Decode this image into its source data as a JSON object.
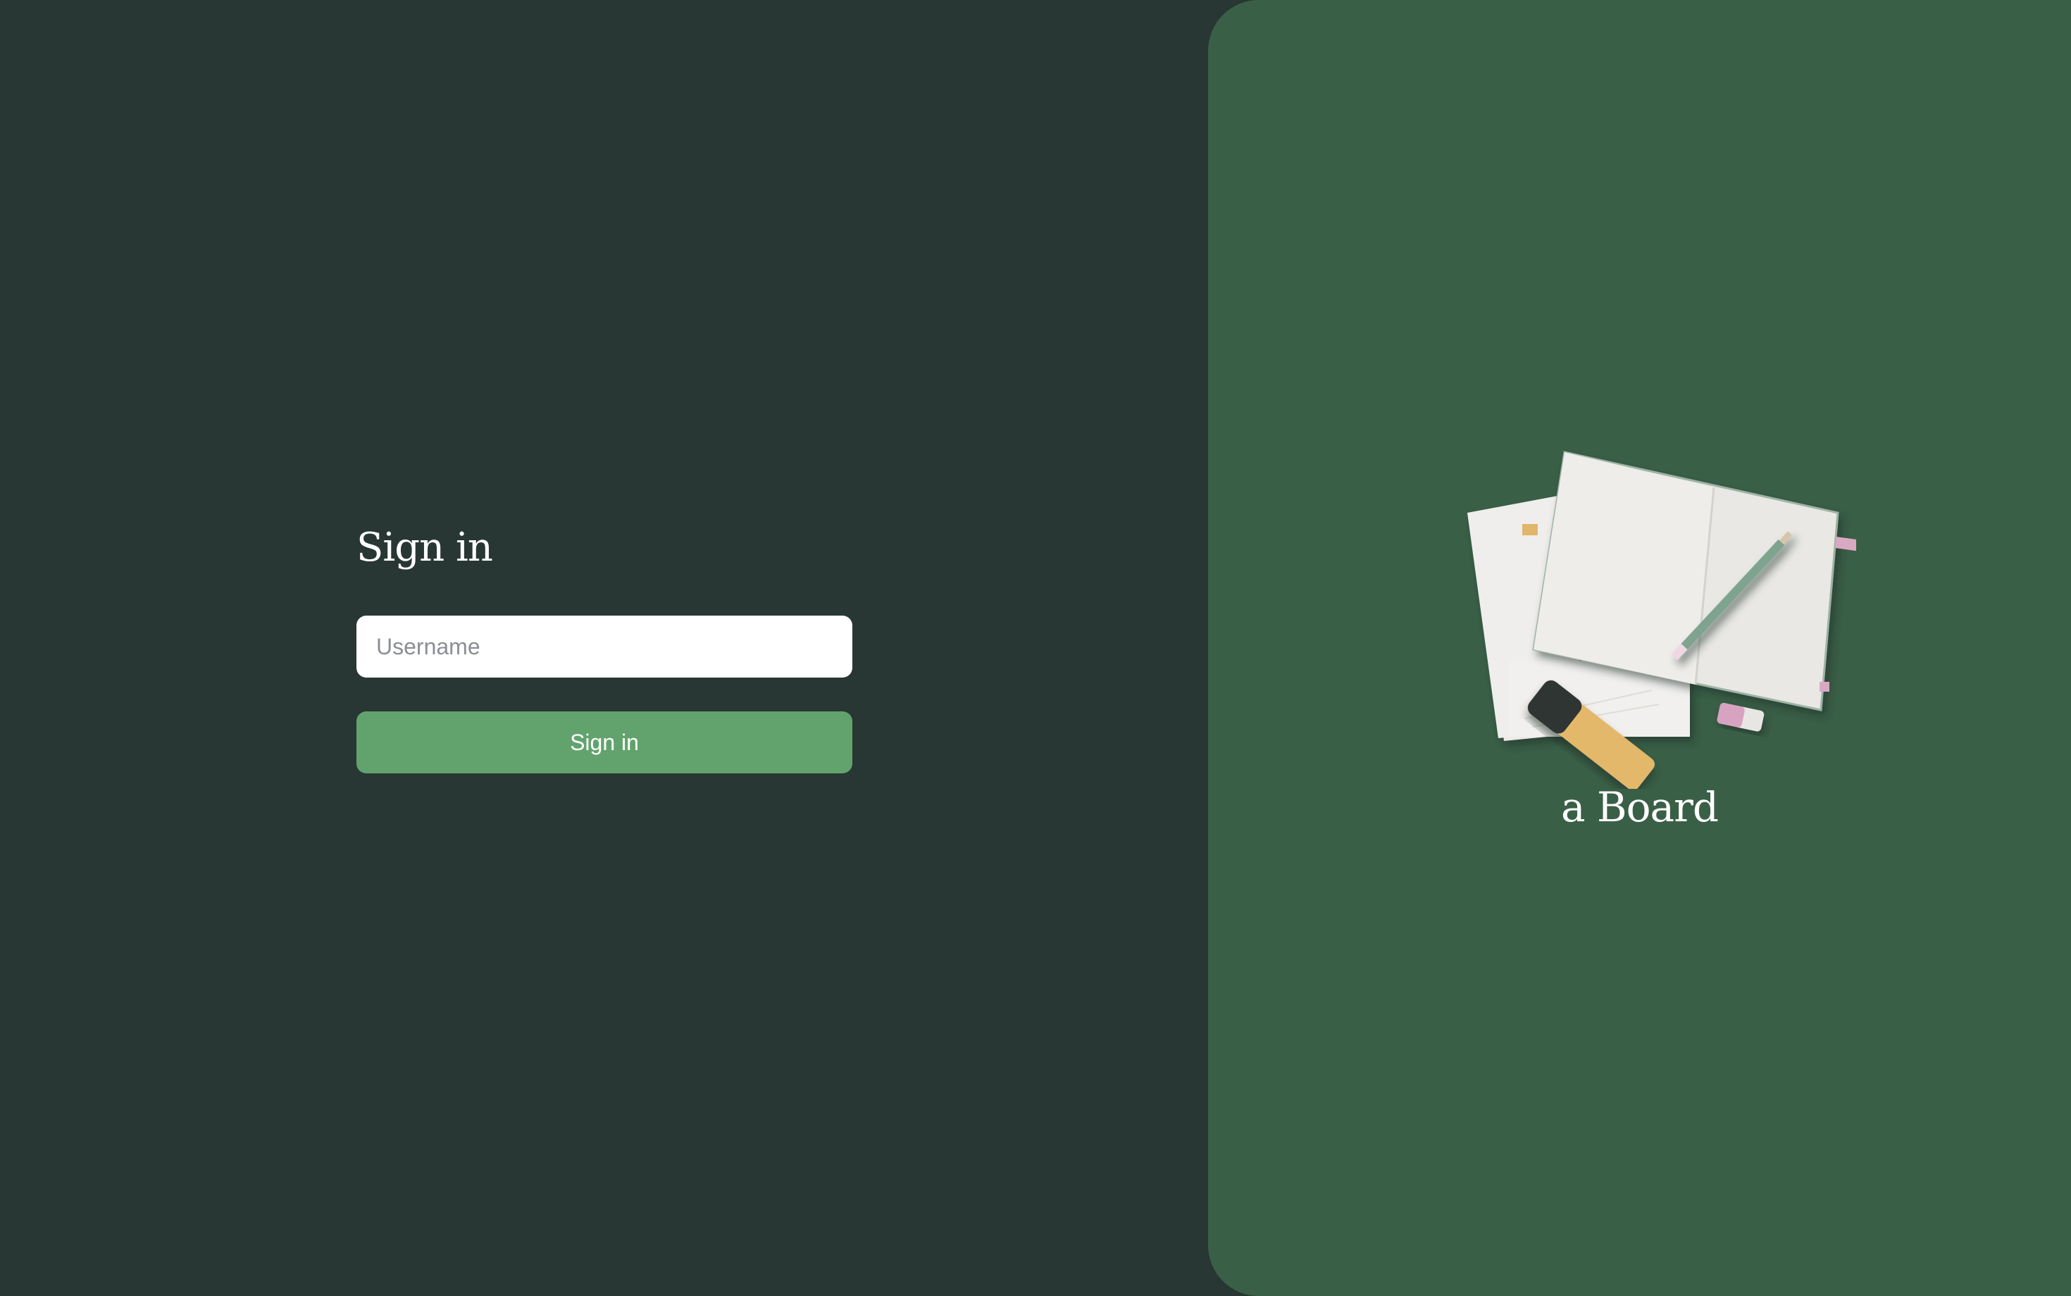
{
  "login": {
    "title": "Sign in",
    "username_placeholder": "Username",
    "submit_label": "Sign in"
  },
  "brand": {
    "name": "a Board"
  },
  "illustration": {
    "icon": "notebook-stationery-illustration"
  },
  "colors": {
    "page_background": "#283733",
    "panel_background": "#3a5f47",
    "button_background": "#62a36d",
    "input_background": "#ffffff",
    "text": "#ffffff"
  }
}
